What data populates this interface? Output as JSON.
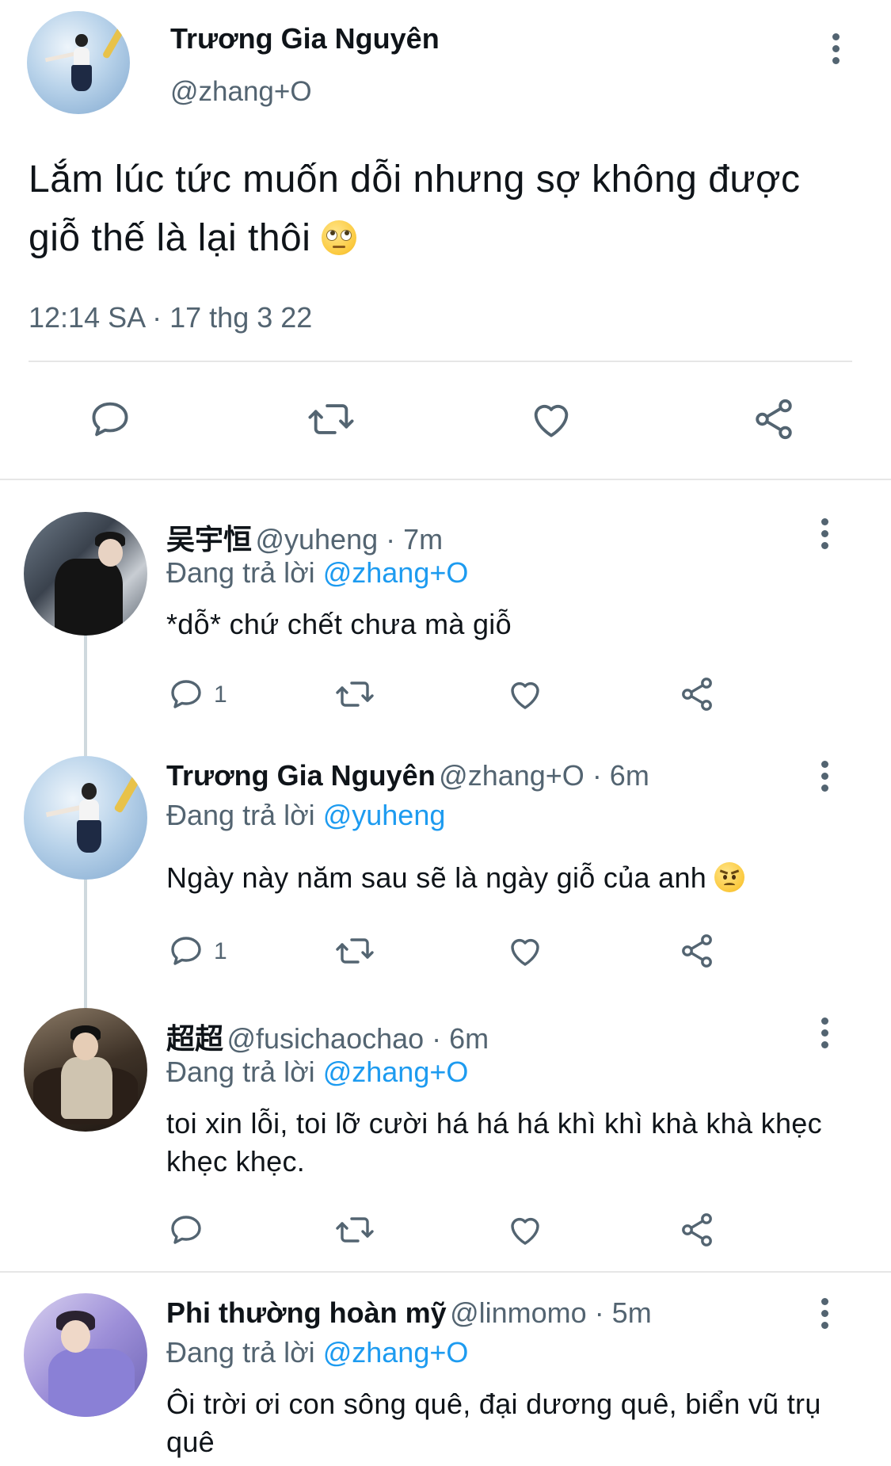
{
  "main_tweet": {
    "author_name": "Trương Gia Nguyên",
    "author_handle": "@zhang+O",
    "text": "Lắm lúc tức muốn dỗi nhưng sợ không được giỗ thế là lại thôi",
    "emoji": "face-with-rolling-eyes",
    "timestamp": "12:14 SA · 17 thg 3 22",
    "actions": [
      "reply-icon",
      "retweet-icon",
      "like-icon",
      "share-icon"
    ]
  },
  "replies": [
    {
      "name": "吴宇恒",
      "handle": "@yuheng · 7m",
      "replying_prefix": "Đang trả lời",
      "replying_to": "@zhang+O",
      "text": "*dỗ* chứ chết chưa mà giỗ",
      "reply_count": "1"
    },
    {
      "name": "Trương Gia Nguyên",
      "handle": "@zhang+O · 6m",
      "replying_prefix": "Đang trả lời",
      "replying_to": "@yuheng",
      "text": "Ngày này năm sau sẽ là ngày giỗ của anh",
      "emoji": "angry-face",
      "reply_count": "1"
    },
    {
      "name": "超超",
      "handle": "@fusichaochao · 6m",
      "replying_prefix": "Đang trả lời",
      "replying_to": "@zhang+O",
      "text": "toi xin lỗi, toi lỡ cười há há há khì khì khà khà khẹc khẹc khẹc."
    },
    {
      "name": "Phi thường hoàn mỹ",
      "handle": "@linmomo · 5m",
      "replying_prefix": "Đang trả lời",
      "replying_to": "@zhang+O",
      "text": "Ôi trời ơi con sông quê, đại dương quê, biển vũ trụ quê"
    }
  ],
  "colors": {
    "text": "#0f1419",
    "secondary": "#536471",
    "accent": "#1d9bf0",
    "divider": "#e6e6e6"
  }
}
